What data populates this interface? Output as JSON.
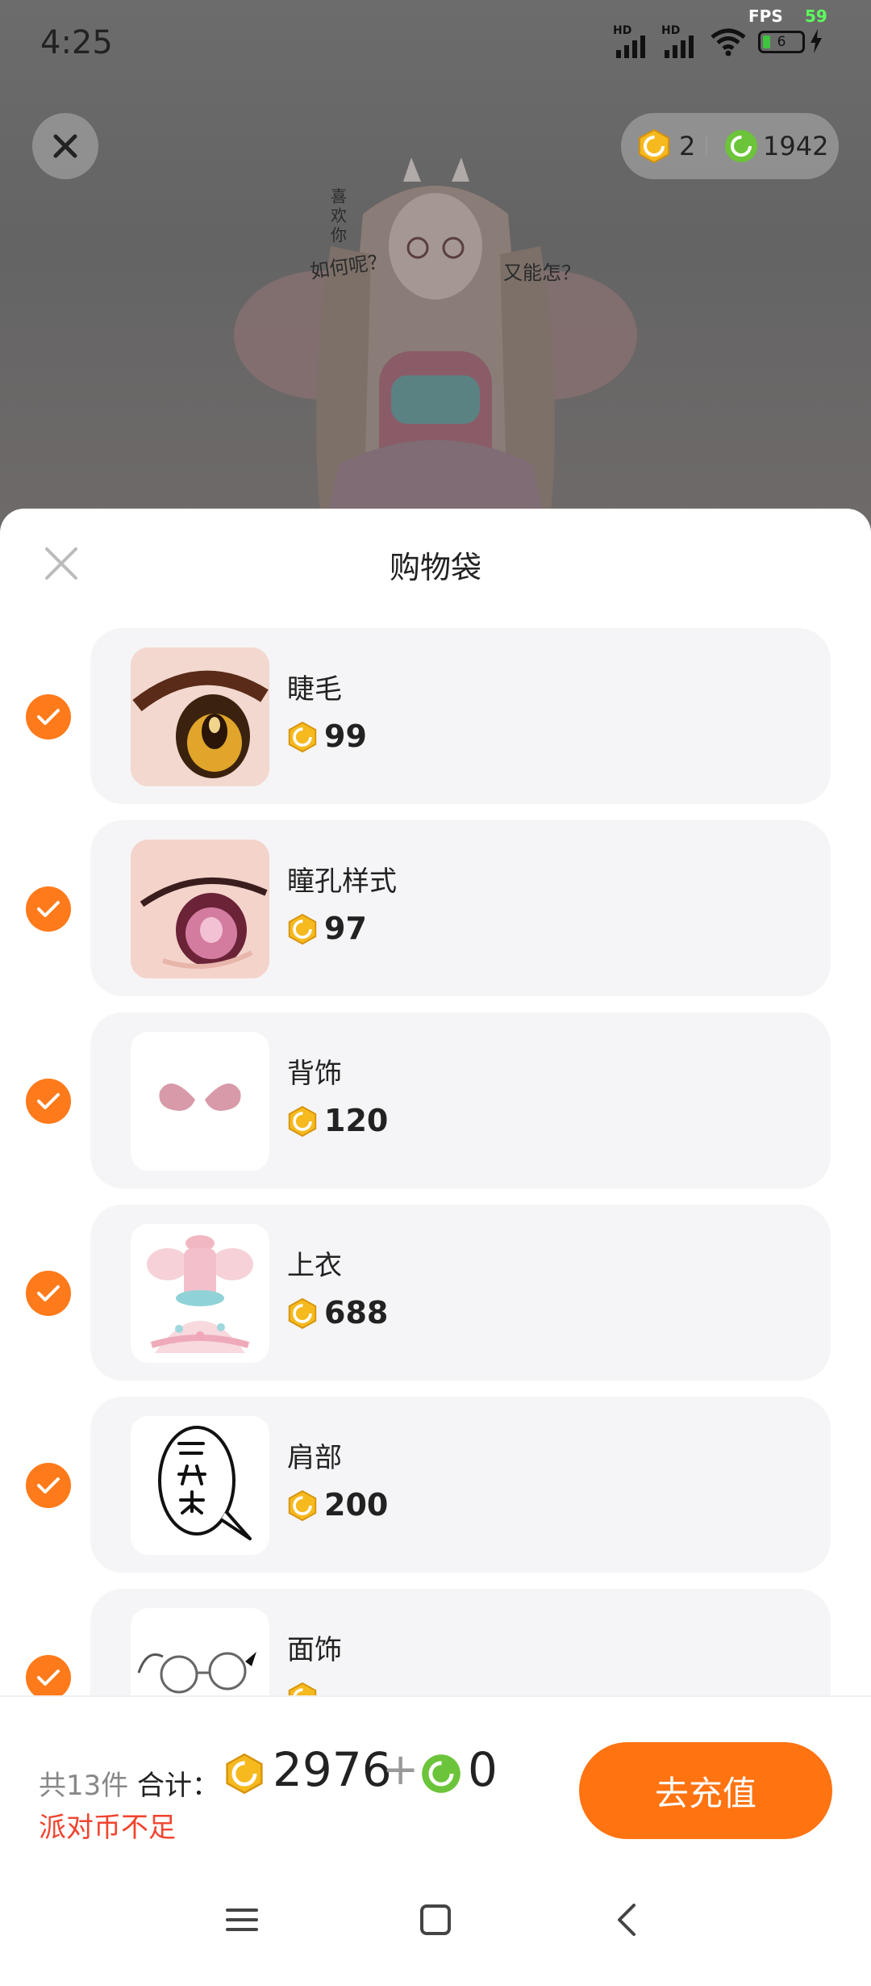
{
  "status_bar": {
    "time": "4:25",
    "fps_label": "FPS",
    "fps_value": "59",
    "battery": "6"
  },
  "top_bar": {
    "gold_balance": "2",
    "green_balance": "1942"
  },
  "avatar_scene": {
    "bubble_line1": "喜",
    "bubble_line2": "欢",
    "bubble_line3": "你",
    "speech_left": "如何呢？",
    "speech_right": "又能怎？"
  },
  "sheet": {
    "title": "购物袋"
  },
  "items": [
    {
      "name": "睫毛",
      "price": "99"
    },
    {
      "name": "瞳孔样式",
      "price": "97"
    },
    {
      "name": "背饰",
      "price": "120"
    },
    {
      "name": "上衣",
      "price": "688"
    },
    {
      "name": "肩部",
      "price": "200"
    },
    {
      "name": "面饰",
      "price": ""
    }
  ],
  "footer": {
    "count": "共13件",
    "total_label": "合计：",
    "gold_total": "2976",
    "plus": "+",
    "green_total": "0",
    "warning": "派对币不足",
    "recharge_label": "去充值"
  },
  "colors": {
    "accent": "#ff7311",
    "warning": "#f0442f",
    "gold_coin": "#f6b91e",
    "green_coin": "#6cc43a"
  },
  "icons": [
    "close-icon",
    "gold-coin-icon",
    "green-coin-icon",
    "check-icon",
    "menu-icon",
    "home-icon",
    "back-icon"
  ]
}
